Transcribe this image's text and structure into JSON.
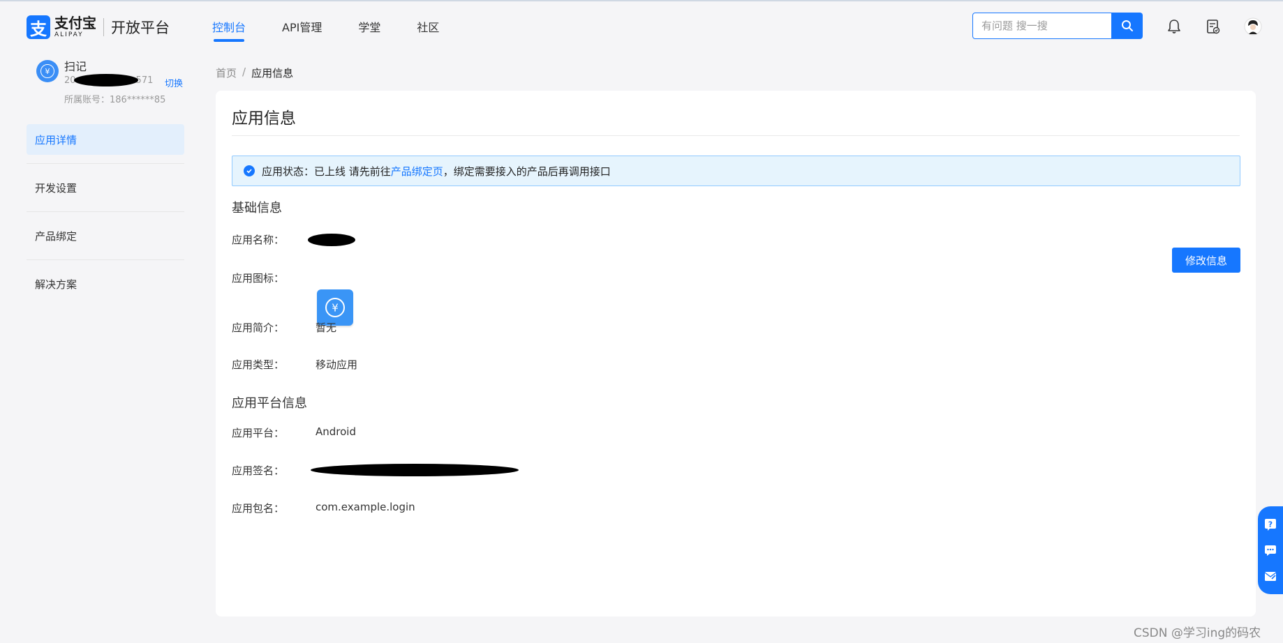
{
  "brand": {
    "logo_glyph": "支",
    "name_cn": "支付宝",
    "name_en": "ALIPAY",
    "platform": "开放平台",
    "color": "#1677ff"
  },
  "nav": {
    "items": [
      {
        "label": "控制台",
        "active": true
      },
      {
        "label": "API管理",
        "active": false
      },
      {
        "label": "学堂",
        "active": false
      },
      {
        "label": "社区",
        "active": false
      }
    ]
  },
  "search": {
    "placeholder": "有问题 搜一搜",
    "icon": "search-icon"
  },
  "header_icons": [
    "bell-icon",
    "document-check-icon",
    "user-avatar-icon"
  ],
  "account": {
    "avatar_glyph": "¥",
    "name": "扫记",
    "id_prefix": "20",
    "id_suffix": "571",
    "switch_label": "切换",
    "owner_label": "所属账号：",
    "owner_value": "186******85"
  },
  "sidebar": {
    "items": [
      {
        "label": "应用详情",
        "active": true
      },
      {
        "label": "开发设置",
        "active": false
      },
      {
        "label": "产品绑定",
        "active": false
      },
      {
        "label": "解决方案",
        "active": false
      }
    ]
  },
  "breadcrumb": {
    "home": "首页",
    "separator": "/",
    "current": "应用信息"
  },
  "main": {
    "title": "应用信息",
    "alert": {
      "prefix": "应用状态：已上线 请先前往",
      "link": "产品绑定页",
      "suffix": "，绑定需要接入的产品后再调用接口"
    },
    "basic_section": "基础信息",
    "edit_button": "修改信息",
    "fields": {
      "name_label": "应用名称：",
      "icon_label": "应用图标：",
      "icon_glyph": "¥",
      "intro_label": "应用简介：",
      "intro_value": "暂无",
      "type_label": "应用类型：",
      "type_value": "移动应用"
    },
    "platform_section": "应用平台信息",
    "platform": {
      "platform_label": "应用平台：",
      "platform_value": "Android",
      "signature_label": "应用签名：",
      "package_label": "应用包名：",
      "package_value": "com.example.login"
    }
  },
  "float_tools": [
    "help-icon",
    "chat-icon",
    "feedback-icon"
  ],
  "watermark": "CSDN @学习ing的码农"
}
